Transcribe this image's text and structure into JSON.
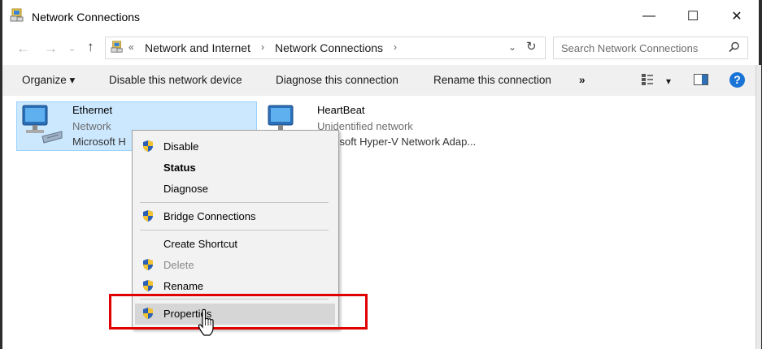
{
  "window": {
    "title": "Network Connections",
    "controls": {
      "minimize": "—",
      "maximize": "☐",
      "close": "✕"
    }
  },
  "address": {
    "overflow": "«",
    "crumbs": [
      "Network and Internet",
      "Network Connections"
    ],
    "separator": "›",
    "dropdown": "⌄",
    "refresh": "↻"
  },
  "search": {
    "placeholder": "Search Network Connections"
  },
  "toolbar": {
    "organize": "Organize ▾",
    "disable": "Disable this network device",
    "diagnose": "Diagnose this connection",
    "rename": "Rename this connection",
    "more": "»",
    "view_drop": "▾",
    "help": "?"
  },
  "connections": [
    {
      "name": "Ethernet",
      "status": "Network",
      "adapter": "Microsoft H"
    },
    {
      "name": "HeartBeat",
      "status": "Unidentified network",
      "adapter": "rosoft Hyper-V Network Adap..."
    }
  ],
  "context_menu": {
    "items": [
      {
        "label": "Disable",
        "shield": true
      },
      {
        "label": "Status",
        "bold": true
      },
      {
        "label": "Diagnose"
      },
      {
        "label": "Bridge Connections",
        "shield": true
      },
      {
        "label": "Create Shortcut"
      },
      {
        "label": "Delete",
        "shield": true,
        "disabled": true
      },
      {
        "label": "Rename",
        "shield": true
      },
      {
        "label": "Properties",
        "shield": true,
        "highlighted": true
      }
    ]
  },
  "colors": {
    "selection": "#cce8ff",
    "highlight_box": "#e00000",
    "help_icon": "#1a73d6"
  }
}
